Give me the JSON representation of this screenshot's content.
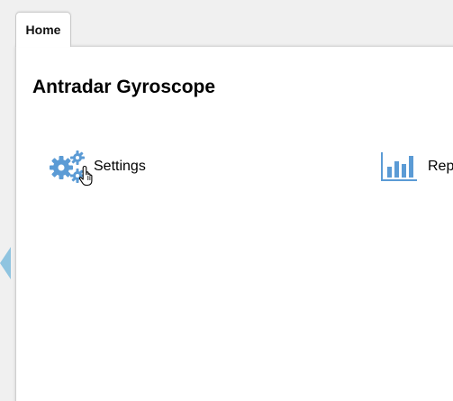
{
  "tabs": [
    {
      "label": "Home",
      "active": true
    }
  ],
  "main": {
    "title": "Antradar Gyroscope",
    "tiles": [
      {
        "label": "Settings",
        "icon": "gears-icon"
      },
      {
        "label": "Rep",
        "icon": "bar-chart-icon"
      }
    ]
  },
  "colors": {
    "accent": "#5b9bd5",
    "handle": "#8fc4e0",
    "panel_border": "#cfcfcf",
    "background": "#f0f0f0"
  },
  "icons": {
    "side_handle": "collapse-left-arrow-icon",
    "cursor": "hand-pointer-icon"
  }
}
